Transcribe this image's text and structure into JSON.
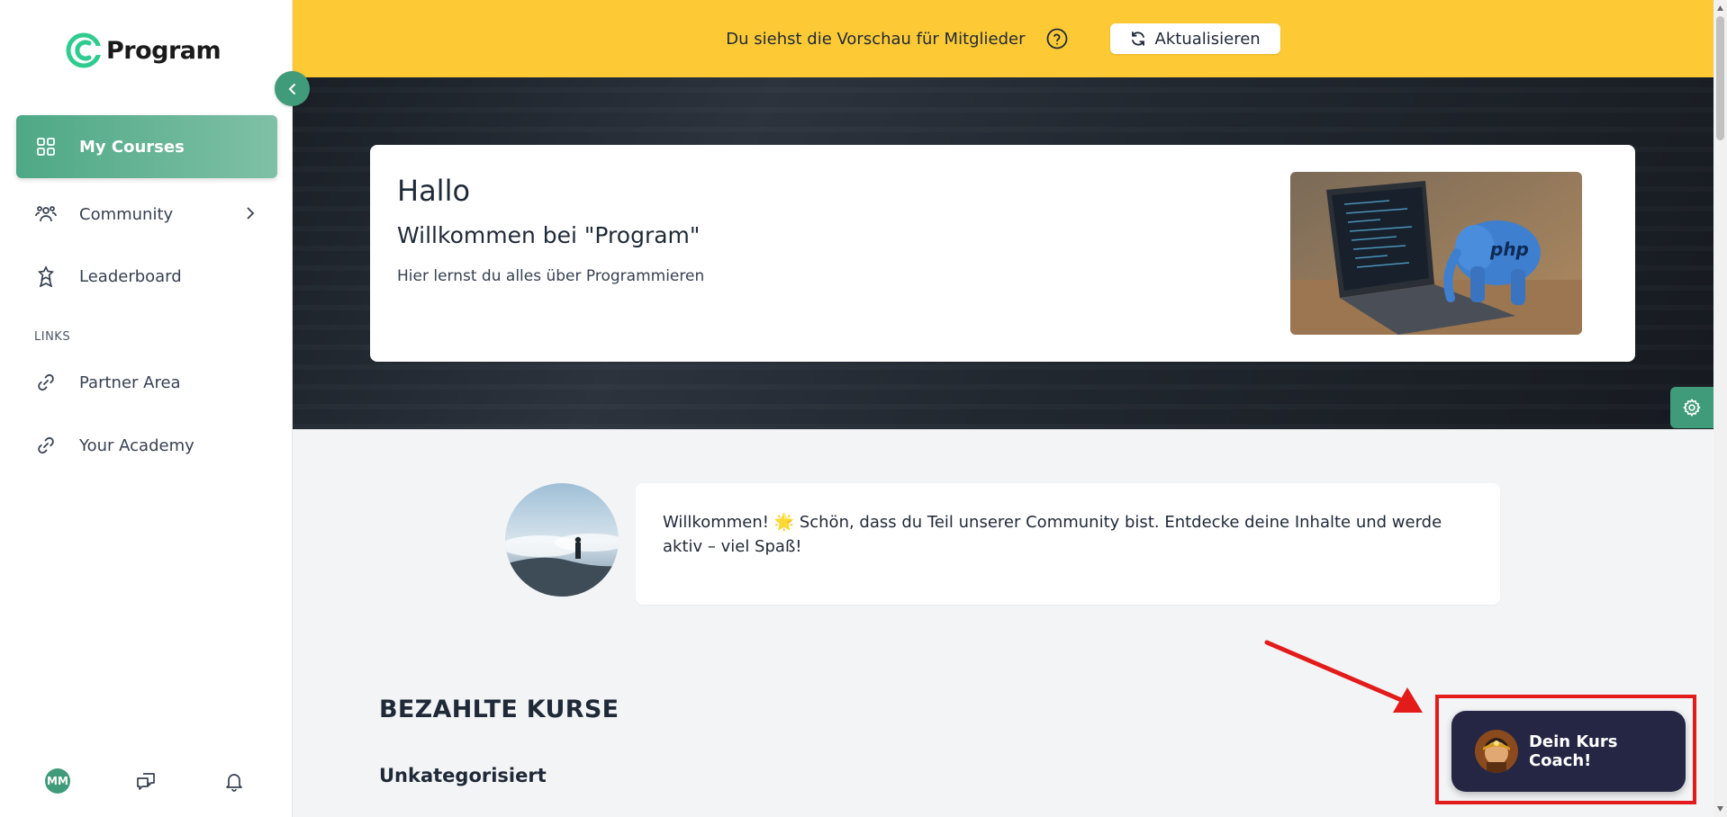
{
  "app": {
    "brand_name": "Program",
    "brand_color": "#3f9b7a"
  },
  "sidebar": {
    "items": [
      {
        "label": "My Courses",
        "icon": "grid-icon",
        "active": true
      },
      {
        "label": "Community",
        "icon": "community-icon",
        "has_submenu": true
      },
      {
        "label": "Leaderboard",
        "icon": "award-icon"
      }
    ],
    "links_section_label": "LINKS",
    "links": [
      {
        "label": "Partner Area",
        "icon": "link-icon"
      },
      {
        "label": "Your Academy",
        "icon": "link-icon"
      }
    ],
    "user_initials": "MM"
  },
  "preview_bar": {
    "text": "Du siehst die Vorschau für Mitglieder",
    "refresh_label": "Aktualisieren",
    "background": "#fdc935"
  },
  "hero": {
    "title": "Hallo",
    "subtitle": "Willkommen bei \"Program\"",
    "description": "Hier lernst du alles über Programmieren",
    "image_text": "php"
  },
  "welcome": {
    "message": "Willkommen! 🌟 Schön, dass du Teil unserer Community bist. Entdecke deine Inhalte und werde aktiv – viel Spaß!"
  },
  "courses": {
    "section_title": "BEZAHLTE KURSE",
    "category": "Unkategorisiert"
  },
  "coach": {
    "label": "Dein Kurs Coach!",
    "highlight_color": "#e31b1b"
  }
}
